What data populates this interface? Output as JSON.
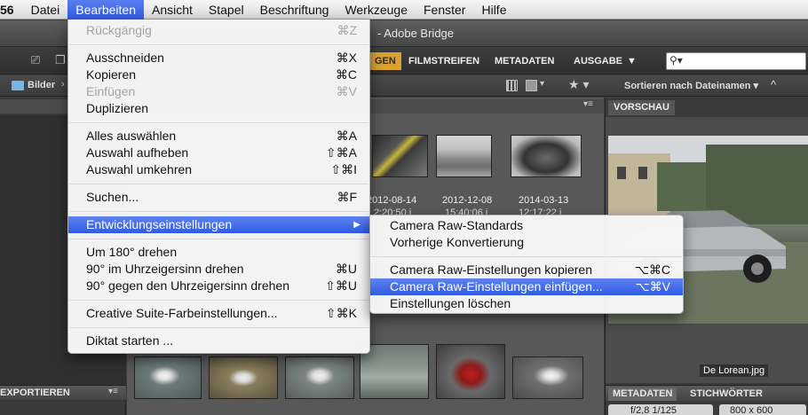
{
  "menubar": {
    "app_fragment": "56",
    "items": [
      "Datei",
      "Bearbeiten",
      "Ansicht",
      "Stapel",
      "Beschriftung",
      "Werkzeuge",
      "Fenster",
      "Hilfe"
    ],
    "active_index": 1
  },
  "window": {
    "title": "- Adobe Bridge"
  },
  "toolbar": {
    "workspace_tabs": [
      "GEN",
      "FILMSTREIFEN",
      "METADATEN",
      "AUSGABE"
    ],
    "workspace_more": "▼",
    "active_tab_index": 0,
    "search_icon_glyph": "⚲▾"
  },
  "pathbar": {
    "breadcrumb": "Bilder",
    "breadcrumb_close": "›",
    "sort_label": "Sortieren nach Dateinamen ▾",
    "sort_direction_icon": "^",
    "filter_star": "★ ▾",
    "filter_grid_caret": "▾",
    "filter_rect_caret": "▾"
  },
  "left_panel": {
    "export_label": "EXPORTIEREN",
    "panel_menu_glyph": "▾≡"
  },
  "content": {
    "panel_menu_glyph": "▾≡",
    "dates": [
      "2012-08-14",
      "2012-12-08",
      "2014-03-13"
    ],
    "subtext": [
      "2:20:50 i",
      "15:40:06 i",
      "12:17:22 i"
    ]
  },
  "right_panel": {
    "preview_tab": "VORSCHAU",
    "preview_caption": "De Lorean.jpg",
    "meta_tabs": [
      "METADATEN",
      "STICHWÖRTER"
    ],
    "exif_left": "f/2,8 1/125",
    "exif_right": "800 x 600"
  },
  "edit_menu": {
    "items": [
      {
        "label": "Rückgängig",
        "shortcut": "⌘Z",
        "disabled": true
      },
      {
        "label": "Ausschneiden",
        "shortcut": "⌘X"
      },
      {
        "label": "Kopieren",
        "shortcut": "⌘C"
      },
      {
        "label": "Einfügen",
        "shortcut": "⌘V",
        "disabled": true
      },
      {
        "label": "Duplizieren",
        "shortcut": ""
      },
      {
        "label": "Alles auswählen",
        "shortcut": "⌘A"
      },
      {
        "label": "Auswahl aufheben",
        "shortcut": "⇧⌘A"
      },
      {
        "label": "Auswahl umkehren",
        "shortcut": "⇧⌘I"
      },
      {
        "label": "Suchen...",
        "shortcut": "⌘F"
      },
      {
        "label": "Entwicklungseinstellungen",
        "submenu_arrow": "▶",
        "highlighted": true
      },
      {
        "label": "Um 180° drehen",
        "shortcut": ""
      },
      {
        "label": "90° im Uhrzeigersinn drehen",
        "shortcut": "⌘U"
      },
      {
        "label": "90° gegen den Uhrzeigersinn drehen",
        "shortcut": "⇧⌘U"
      },
      {
        "label": "Creative Suite-Farbeinstellungen...",
        "shortcut": "⇧⌘K"
      },
      {
        "label": "Diktat starten ...",
        "shortcut": ""
      }
    ]
  },
  "sub_menu": {
    "items": [
      {
        "label": "Camera Raw-Standards",
        "shortcut": ""
      },
      {
        "label": "Vorherige Konvertierung",
        "shortcut": ""
      },
      {
        "label": "Camera Raw-Einstellungen kopieren",
        "shortcut": "⌥⌘C"
      },
      {
        "label": "Camera Raw-Einstellungen einfügen...",
        "shortcut": "⌥⌘V",
        "highlighted": true
      },
      {
        "label": "Einstellungen löschen",
        "shortcut": ""
      }
    ]
  },
  "colors": {
    "highlight": "#2f5ce3",
    "workspace_active": "#d8a332"
  }
}
